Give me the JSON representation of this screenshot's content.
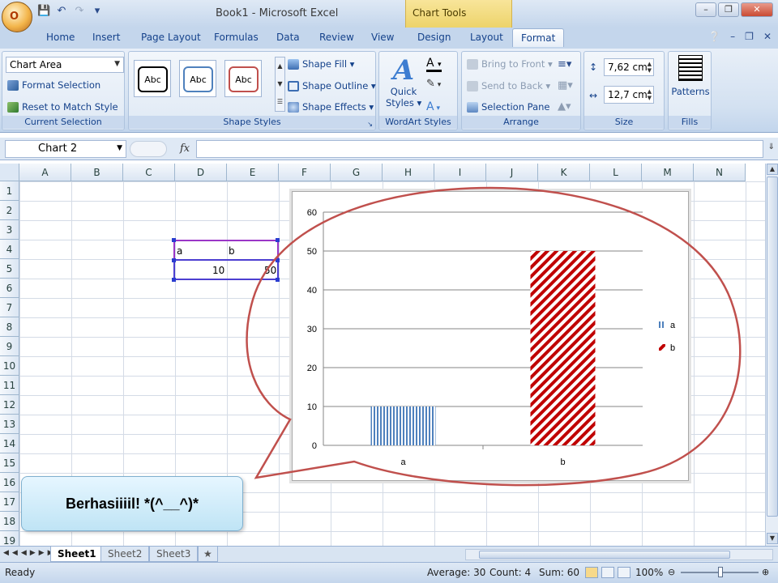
{
  "window": {
    "title": "Book1 - Microsoft Excel",
    "context_tab_group": "Chart Tools",
    "office_button_glyph": "O"
  },
  "tabs": [
    "Home",
    "Insert",
    "Page Layout",
    "Formulas",
    "Data",
    "Review",
    "View",
    "Design",
    "Layout",
    "Format"
  ],
  "active_tab": "Format",
  "ribbon": {
    "current_selection": {
      "dropdown_value": "Chart Area",
      "format_selection": "Format Selection",
      "reset_style": "Reset to Match Style",
      "label": "Current Selection"
    },
    "shape_styles": {
      "swatch_text": "Abc",
      "swatch_colors": [
        "#000000",
        "#4f81bd",
        "#c0504d"
      ],
      "fill": "Shape Fill",
      "outline": "Shape Outline",
      "effects": "Shape Effects",
      "label": "Shape Styles"
    },
    "wordart_styles": {
      "quick_styles": "Quick",
      "quick_styles_2": "Styles",
      "label": "WordArt Styles"
    },
    "arrange": {
      "bring_to_front": "Bring to Front",
      "send_to_back": "Send to Back",
      "selection_pane": "Selection Pane",
      "label": "Arrange"
    },
    "size": {
      "height": "7,62 cm",
      "width": "12,7 cm",
      "label": "Size"
    },
    "fills": {
      "patterns": "Patterns",
      "label": "Fills"
    }
  },
  "formula_bar": {
    "name_box": "Chart 2",
    "fx": "fx",
    "content": ""
  },
  "columns": [
    "A",
    "B",
    "C",
    "D",
    "E",
    "F",
    "G",
    "H",
    "I",
    "J",
    "K",
    "L",
    "M",
    "N"
  ],
  "rows": [
    "1",
    "2",
    "3",
    "4",
    "5",
    "6",
    "7",
    "8",
    "9",
    "10",
    "11",
    "12",
    "13",
    "14",
    "15",
    "16",
    "17",
    "18",
    "19"
  ],
  "cells": {
    "D4": "a",
    "E4": "b",
    "D5": "10",
    "E5": "50"
  },
  "chart_data": {
    "type": "bar",
    "categories": [
      "a",
      "b"
    ],
    "series": [
      {
        "name": "a",
        "values": [
          10,
          null
        ],
        "color": "#4f81bd",
        "pattern": "vertical-lines"
      },
      {
        "name": "b",
        "values": [
          null,
          50
        ],
        "color": "#c00000",
        "pattern": "diagonal-lines"
      }
    ],
    "y_ticks": [
      "0",
      "10",
      "20",
      "30",
      "40",
      "50",
      "60"
    ],
    "ylim": [
      0,
      60
    ],
    "grid": true,
    "legend_position": "right",
    "title": "",
    "xlabel": "",
    "ylabel": ""
  },
  "caption": "Berhasiiiil! *(^__^)*",
  "sheets": [
    "Sheet1",
    "Sheet2",
    "Sheet3"
  ],
  "active_sheet": "Sheet1",
  "status": {
    "ready": "Ready",
    "average": "Average: 30",
    "count": "Count: 4",
    "sum": "Sum: 60",
    "zoom": "100%"
  }
}
